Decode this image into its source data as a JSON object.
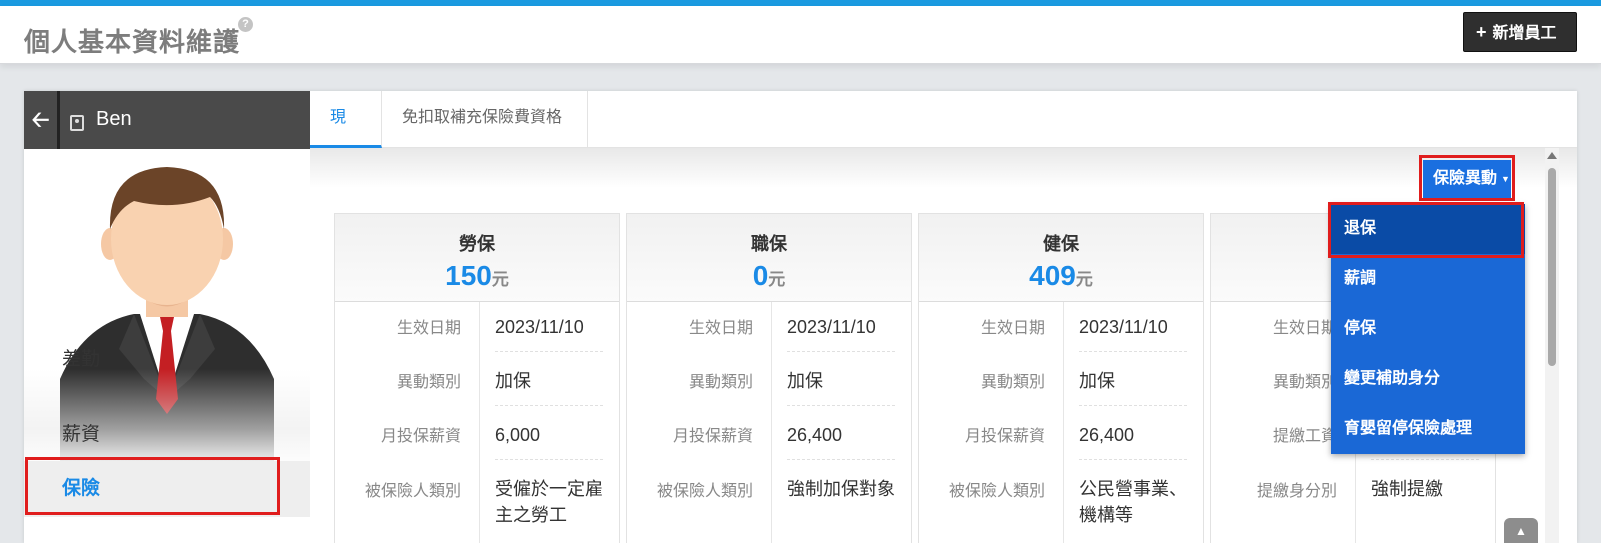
{
  "header": {
    "title": "個人基本資料維護",
    "help_icon": "?",
    "add_button": {
      "icon": "+",
      "label": "新增員工"
    }
  },
  "employee": {
    "name": "Ben"
  },
  "sidebar": {
    "items": [
      {
        "label": "差勤"
      },
      {
        "label": "薪資"
      },
      {
        "label": "保險",
        "selected": true
      }
    ]
  },
  "tabs": [
    {
      "label": "現況",
      "active": true
    },
    {
      "label": "免扣取補充保險費資格",
      "active": false
    }
  ],
  "insurance_change": {
    "label": "保險異動",
    "menu": [
      "退保",
      "薪調",
      "停保",
      "變更補助身分",
      "育嬰留停保險處理"
    ]
  },
  "columns": [
    {
      "title": "勞保",
      "amount": "150",
      "unit": "元",
      "rows": [
        {
          "label": "生效日期",
          "value": "2023/11/10"
        },
        {
          "label": "異動類別",
          "value": "加保"
        },
        {
          "label": "月投保薪資",
          "value": "6,000"
        },
        {
          "label": "被保險人類別",
          "value": "受僱於一定雇主之勞工"
        }
      ]
    },
    {
      "title": "職保",
      "amount": "0",
      "unit": "元",
      "rows": [
        {
          "label": "生效日期",
          "value": "2023/11/10"
        },
        {
          "label": "異動類別",
          "value": "加保"
        },
        {
          "label": "月投保薪資",
          "value": "26,400"
        },
        {
          "label": "被保險人類別",
          "value": "強制加保對象"
        }
      ]
    },
    {
      "title": "健保",
      "amount": "409",
      "unit": "元",
      "rows": [
        {
          "label": "生效日期",
          "value": "2023/11/10"
        },
        {
          "label": "異動類別",
          "value": "加保"
        },
        {
          "label": "月投保薪資",
          "value": "26,400"
        },
        {
          "label": "被保險人類別",
          "value": "公民營事業、機構等"
        }
      ]
    },
    {
      "rows": [
        {
          "label": "生效日期",
          "value": ""
        },
        {
          "label": "異動類別",
          "value": ""
        },
        {
          "label": "提繳工資",
          "value": ""
        },
        {
          "label": "提繳身分別",
          "value": "強制提繳"
        }
      ]
    }
  ],
  "colors": {
    "accent": "#1a8ae6",
    "menu_bg": "#1a68d6",
    "highlight": "#e01d1d"
  }
}
